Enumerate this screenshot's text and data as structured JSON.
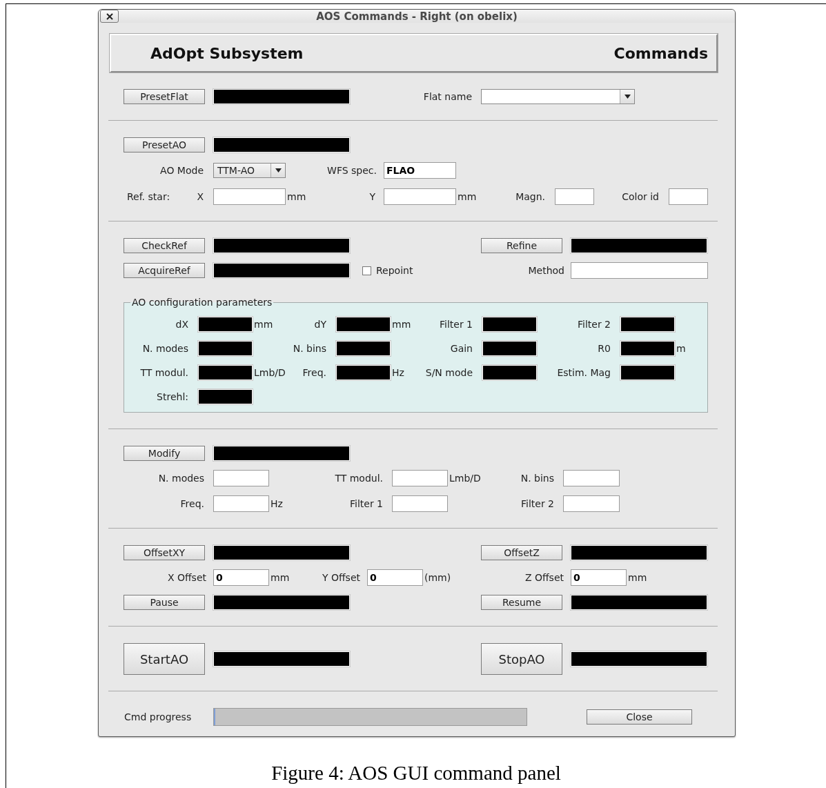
{
  "window": {
    "title": "AOS Commands - Right (on obelix)"
  },
  "header": {
    "left": "AdOpt Subsystem",
    "right": "Commands"
  },
  "preset_flat": {
    "button": "PresetFlat",
    "flat_name": {
      "label": "Flat name"
    }
  },
  "preset_ao": {
    "button": "PresetAO",
    "ao_mode": {
      "label": "AO Mode",
      "value": "TTM-AO"
    },
    "wfs_spec": {
      "label": "WFS spec.",
      "value": "FLAO"
    },
    "ref_star": {
      "label": "Ref. star:",
      "x_label": "X",
      "x_unit": "mm",
      "y_label": "Y",
      "y_unit": "mm",
      "magn_label": "Magn.",
      "color_label": "Color id"
    }
  },
  "check_ref": {
    "button": "CheckRef",
    "refine_button": "Refine"
  },
  "acquire_ref": {
    "button": "AcquireRef",
    "repoint": {
      "label": "Repoint",
      "checked": false
    },
    "method_label": "Method"
  },
  "ao_config": {
    "title": "AO configuration parameters",
    "rows": [
      {
        "params": [
          {
            "label": "dX",
            "unit": "mm"
          },
          {
            "label": "dY",
            "unit": "mm"
          },
          {
            "label": "Filter 1"
          },
          {
            "label": "Filter 2"
          }
        ]
      },
      {
        "params": [
          {
            "label": "N. modes"
          },
          {
            "label": "N. bins"
          },
          {
            "label": "Gain"
          },
          {
            "label": "R0",
            "unit": "m"
          }
        ]
      },
      {
        "params": [
          {
            "label": "TT modul.",
            "unit": "Lmb/D"
          },
          {
            "label": "Freq.",
            "unit": "Hz"
          },
          {
            "label": "S/N mode"
          },
          {
            "label": "Estim. Mag"
          }
        ]
      },
      {
        "params": [
          {
            "label": "Strehl:"
          }
        ]
      }
    ]
  },
  "modify": {
    "button": "Modify",
    "rows": [
      {
        "fields": [
          {
            "label": "N. modes"
          },
          {
            "label": "TT modul.",
            "unit": "Lmb/D"
          },
          {
            "label": "N. bins"
          }
        ]
      },
      {
        "fields": [
          {
            "label": "Freq.",
            "unit": "Hz"
          },
          {
            "label": "Filter 1"
          },
          {
            "label": "Filter 2"
          }
        ]
      }
    ]
  },
  "offset": {
    "xy_button": "OffsetXY",
    "z_button": "OffsetZ",
    "fields": [
      {
        "label": "X Offset",
        "value": "0",
        "unit": "mm"
      },
      {
        "label": "Y Offset",
        "value": "0",
        "unit": "(mm)"
      },
      {
        "label": "Z Offset",
        "value": "0",
        "unit": "mm"
      }
    ],
    "pause_button": "Pause",
    "resume_button": "Resume"
  },
  "ao_control": {
    "start_button": "StartAO",
    "stop_button": "StopAO"
  },
  "cmd_progress": {
    "label": "Cmd progress",
    "level": 0,
    "close_button": "Close"
  },
  "caption": "Figure 4: AOS GUI command panel"
}
